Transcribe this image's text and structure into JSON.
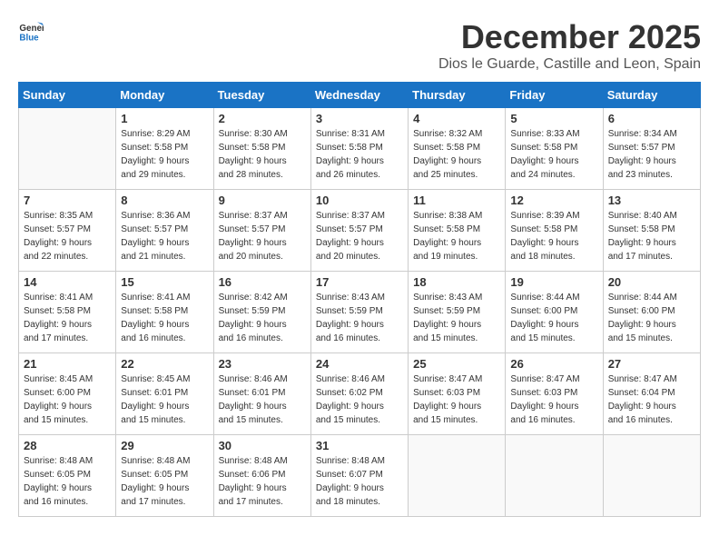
{
  "logo": {
    "line1": "General",
    "line2": "Blue"
  },
  "title": "December 2025",
  "subtitle": "Dios le Guarde, Castille and Leon, Spain",
  "weekdays": [
    "Sunday",
    "Monday",
    "Tuesday",
    "Wednesday",
    "Thursday",
    "Friday",
    "Saturday"
  ],
  "weeks": [
    [
      {
        "day": "",
        "info": ""
      },
      {
        "day": "1",
        "info": "Sunrise: 8:29 AM\nSunset: 5:58 PM\nDaylight: 9 hours\nand 29 minutes."
      },
      {
        "day": "2",
        "info": "Sunrise: 8:30 AM\nSunset: 5:58 PM\nDaylight: 9 hours\nand 28 minutes."
      },
      {
        "day": "3",
        "info": "Sunrise: 8:31 AM\nSunset: 5:58 PM\nDaylight: 9 hours\nand 26 minutes."
      },
      {
        "day": "4",
        "info": "Sunrise: 8:32 AM\nSunset: 5:58 PM\nDaylight: 9 hours\nand 25 minutes."
      },
      {
        "day": "5",
        "info": "Sunrise: 8:33 AM\nSunset: 5:58 PM\nDaylight: 9 hours\nand 24 minutes."
      },
      {
        "day": "6",
        "info": "Sunrise: 8:34 AM\nSunset: 5:57 PM\nDaylight: 9 hours\nand 23 minutes."
      }
    ],
    [
      {
        "day": "7",
        "info": "Sunrise: 8:35 AM\nSunset: 5:57 PM\nDaylight: 9 hours\nand 22 minutes."
      },
      {
        "day": "8",
        "info": "Sunrise: 8:36 AM\nSunset: 5:57 PM\nDaylight: 9 hours\nand 21 minutes."
      },
      {
        "day": "9",
        "info": "Sunrise: 8:37 AM\nSunset: 5:57 PM\nDaylight: 9 hours\nand 20 minutes."
      },
      {
        "day": "10",
        "info": "Sunrise: 8:37 AM\nSunset: 5:57 PM\nDaylight: 9 hours\nand 20 minutes."
      },
      {
        "day": "11",
        "info": "Sunrise: 8:38 AM\nSunset: 5:58 PM\nDaylight: 9 hours\nand 19 minutes."
      },
      {
        "day": "12",
        "info": "Sunrise: 8:39 AM\nSunset: 5:58 PM\nDaylight: 9 hours\nand 18 minutes."
      },
      {
        "day": "13",
        "info": "Sunrise: 8:40 AM\nSunset: 5:58 PM\nDaylight: 9 hours\nand 17 minutes."
      }
    ],
    [
      {
        "day": "14",
        "info": "Sunrise: 8:41 AM\nSunset: 5:58 PM\nDaylight: 9 hours\nand 17 minutes."
      },
      {
        "day": "15",
        "info": "Sunrise: 8:41 AM\nSunset: 5:58 PM\nDaylight: 9 hours\nand 16 minutes."
      },
      {
        "day": "16",
        "info": "Sunrise: 8:42 AM\nSunset: 5:59 PM\nDaylight: 9 hours\nand 16 minutes."
      },
      {
        "day": "17",
        "info": "Sunrise: 8:43 AM\nSunset: 5:59 PM\nDaylight: 9 hours\nand 16 minutes."
      },
      {
        "day": "18",
        "info": "Sunrise: 8:43 AM\nSunset: 5:59 PM\nDaylight: 9 hours\nand 15 minutes."
      },
      {
        "day": "19",
        "info": "Sunrise: 8:44 AM\nSunset: 6:00 PM\nDaylight: 9 hours\nand 15 minutes."
      },
      {
        "day": "20",
        "info": "Sunrise: 8:44 AM\nSunset: 6:00 PM\nDaylight: 9 hours\nand 15 minutes."
      }
    ],
    [
      {
        "day": "21",
        "info": "Sunrise: 8:45 AM\nSunset: 6:00 PM\nDaylight: 9 hours\nand 15 minutes."
      },
      {
        "day": "22",
        "info": "Sunrise: 8:45 AM\nSunset: 6:01 PM\nDaylight: 9 hours\nand 15 minutes."
      },
      {
        "day": "23",
        "info": "Sunrise: 8:46 AM\nSunset: 6:01 PM\nDaylight: 9 hours\nand 15 minutes."
      },
      {
        "day": "24",
        "info": "Sunrise: 8:46 AM\nSunset: 6:02 PM\nDaylight: 9 hours\nand 15 minutes."
      },
      {
        "day": "25",
        "info": "Sunrise: 8:47 AM\nSunset: 6:03 PM\nDaylight: 9 hours\nand 15 minutes."
      },
      {
        "day": "26",
        "info": "Sunrise: 8:47 AM\nSunset: 6:03 PM\nDaylight: 9 hours\nand 16 minutes."
      },
      {
        "day": "27",
        "info": "Sunrise: 8:47 AM\nSunset: 6:04 PM\nDaylight: 9 hours\nand 16 minutes."
      }
    ],
    [
      {
        "day": "28",
        "info": "Sunrise: 8:48 AM\nSunset: 6:05 PM\nDaylight: 9 hours\nand 16 minutes."
      },
      {
        "day": "29",
        "info": "Sunrise: 8:48 AM\nSunset: 6:05 PM\nDaylight: 9 hours\nand 17 minutes."
      },
      {
        "day": "30",
        "info": "Sunrise: 8:48 AM\nSunset: 6:06 PM\nDaylight: 9 hours\nand 17 minutes."
      },
      {
        "day": "31",
        "info": "Sunrise: 8:48 AM\nSunset: 6:07 PM\nDaylight: 9 hours\nand 18 minutes."
      },
      {
        "day": "",
        "info": ""
      },
      {
        "day": "",
        "info": ""
      },
      {
        "day": "",
        "info": ""
      }
    ]
  ]
}
